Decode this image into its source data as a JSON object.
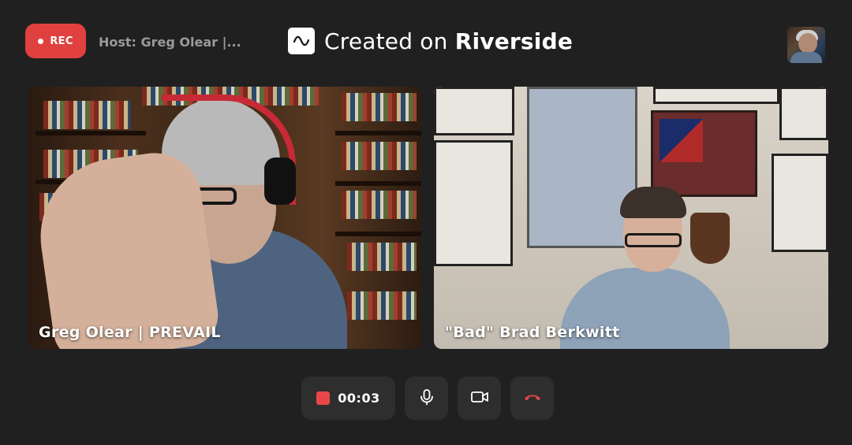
{
  "recording": {
    "label": "REC",
    "accent": "#e0413f"
  },
  "host": {
    "label": "Host: Greg Olear |..."
  },
  "brand": {
    "prefix": "Created on ",
    "name": "Riverside",
    "logo_icon": "waveform-icon"
  },
  "self_view": {
    "icon": "avatar"
  },
  "participants": [
    {
      "name": "Greg Olear | PREVAIL"
    },
    {
      "name": "\"Bad\" Brad Berkwitt"
    }
  ],
  "controls": {
    "timer": "00:03",
    "stop_color": "#ea4848",
    "buttons": [
      {
        "icon": "microphone-icon"
      },
      {
        "icon": "camera-icon"
      },
      {
        "icon": "hang-up-icon",
        "color": "#ea4848"
      }
    ]
  },
  "colors": {
    "background": "#202020",
    "control_bg": "#2e2e2e"
  }
}
